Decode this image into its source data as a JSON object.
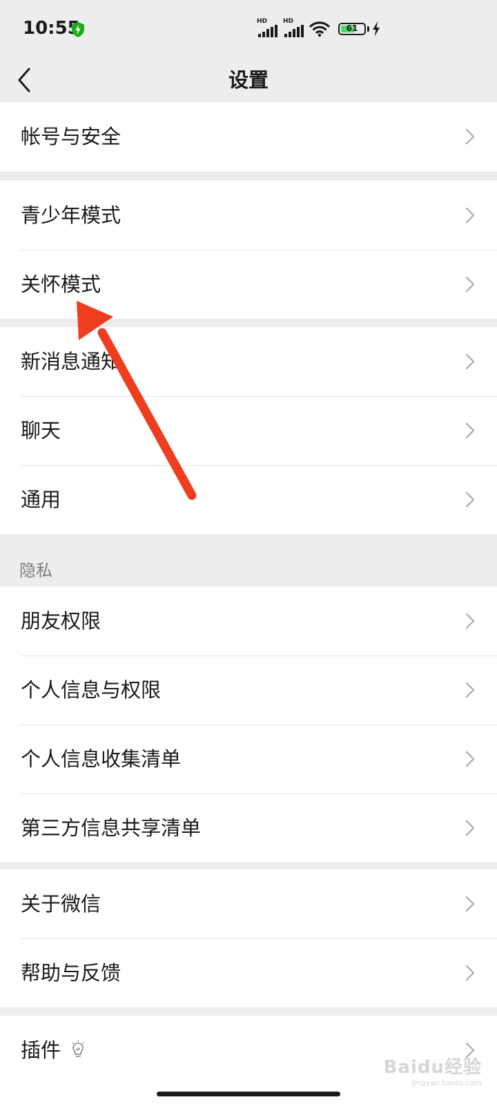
{
  "status_bar": {
    "time": "10:55",
    "signal_badge_1": "HD",
    "signal_badge_2": "HD",
    "battery_level": "61",
    "battery_fraction": 0.61,
    "shield_color": "#1aad19"
  },
  "nav": {
    "title": "设置"
  },
  "groups": {
    "account": {
      "items": [
        {
          "label": "帐号与安全"
        }
      ]
    },
    "modes": {
      "items": [
        {
          "label": "青少年模式"
        },
        {
          "label": "关怀模式"
        }
      ]
    },
    "general": {
      "items": [
        {
          "label": "新消息通知"
        },
        {
          "label": "聊天"
        },
        {
          "label": "通用"
        }
      ]
    },
    "privacy": {
      "header": "隐私",
      "items": [
        {
          "label": "朋友权限"
        },
        {
          "label": "个人信息与权限"
        },
        {
          "label": "个人信息收集清单"
        },
        {
          "label": "第三方信息共享清单"
        }
      ]
    },
    "about": {
      "items": [
        {
          "label": "关于微信"
        },
        {
          "label": "帮助与反馈"
        }
      ]
    },
    "plugins": {
      "items": [
        {
          "label": "插件",
          "icon": "lightbulb-icon"
        }
      ]
    }
  },
  "annotation": {
    "color": "#f03c1f"
  },
  "watermark": {
    "text": "Baidu经验",
    "subtext": "jingyan.baidu.com"
  },
  "colors": {
    "background": "#ededed",
    "cell": "#ffffff",
    "text": "#1a1a1a",
    "secondary_text": "#7f7f7f",
    "chevron": "#b2b2b2"
  }
}
